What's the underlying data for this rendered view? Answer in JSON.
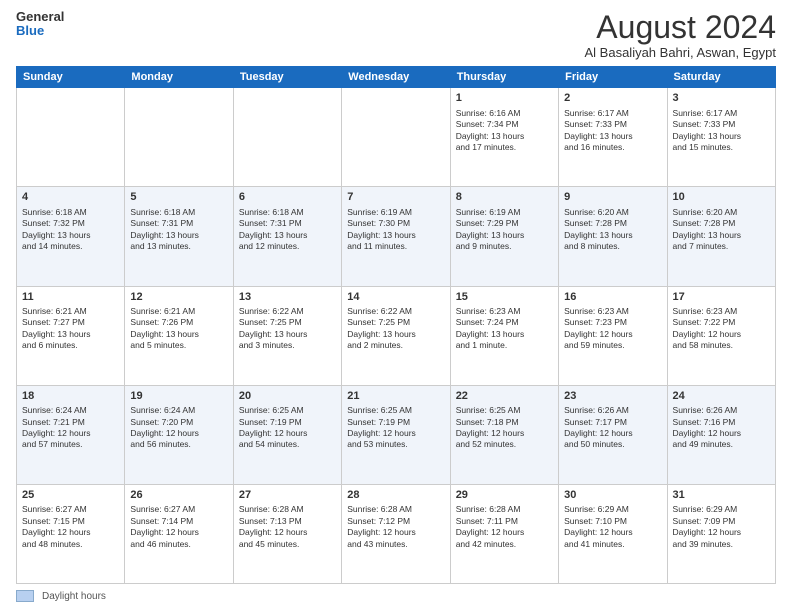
{
  "logo": {
    "line1": "General",
    "line2": "Blue"
  },
  "title": "August 2024",
  "subtitle": "Al Basaliyah Bahri, Aswan, Egypt",
  "days_of_week": [
    "Sunday",
    "Monday",
    "Tuesday",
    "Wednesday",
    "Thursday",
    "Friday",
    "Saturday"
  ],
  "weeks": [
    {
      "alt": false,
      "days": [
        {
          "num": "",
          "info": ""
        },
        {
          "num": "",
          "info": ""
        },
        {
          "num": "",
          "info": ""
        },
        {
          "num": "",
          "info": ""
        },
        {
          "num": "1",
          "info": "Sunrise: 6:16 AM\nSunset: 7:34 PM\nDaylight: 13 hours\nand 17 minutes."
        },
        {
          "num": "2",
          "info": "Sunrise: 6:17 AM\nSunset: 7:33 PM\nDaylight: 13 hours\nand 16 minutes."
        },
        {
          "num": "3",
          "info": "Sunrise: 6:17 AM\nSunset: 7:33 PM\nDaylight: 13 hours\nand 15 minutes."
        }
      ]
    },
    {
      "alt": true,
      "days": [
        {
          "num": "4",
          "info": "Sunrise: 6:18 AM\nSunset: 7:32 PM\nDaylight: 13 hours\nand 14 minutes."
        },
        {
          "num": "5",
          "info": "Sunrise: 6:18 AM\nSunset: 7:31 PM\nDaylight: 13 hours\nand 13 minutes."
        },
        {
          "num": "6",
          "info": "Sunrise: 6:18 AM\nSunset: 7:31 PM\nDaylight: 13 hours\nand 12 minutes."
        },
        {
          "num": "7",
          "info": "Sunrise: 6:19 AM\nSunset: 7:30 PM\nDaylight: 13 hours\nand 11 minutes."
        },
        {
          "num": "8",
          "info": "Sunrise: 6:19 AM\nSunset: 7:29 PM\nDaylight: 13 hours\nand 9 minutes."
        },
        {
          "num": "9",
          "info": "Sunrise: 6:20 AM\nSunset: 7:28 PM\nDaylight: 13 hours\nand 8 minutes."
        },
        {
          "num": "10",
          "info": "Sunrise: 6:20 AM\nSunset: 7:28 PM\nDaylight: 13 hours\nand 7 minutes."
        }
      ]
    },
    {
      "alt": false,
      "days": [
        {
          "num": "11",
          "info": "Sunrise: 6:21 AM\nSunset: 7:27 PM\nDaylight: 13 hours\nand 6 minutes."
        },
        {
          "num": "12",
          "info": "Sunrise: 6:21 AM\nSunset: 7:26 PM\nDaylight: 13 hours\nand 5 minutes."
        },
        {
          "num": "13",
          "info": "Sunrise: 6:22 AM\nSunset: 7:25 PM\nDaylight: 13 hours\nand 3 minutes."
        },
        {
          "num": "14",
          "info": "Sunrise: 6:22 AM\nSunset: 7:25 PM\nDaylight: 13 hours\nand 2 minutes."
        },
        {
          "num": "15",
          "info": "Sunrise: 6:23 AM\nSunset: 7:24 PM\nDaylight: 13 hours\nand 1 minute."
        },
        {
          "num": "16",
          "info": "Sunrise: 6:23 AM\nSunset: 7:23 PM\nDaylight: 12 hours\nand 59 minutes."
        },
        {
          "num": "17",
          "info": "Sunrise: 6:23 AM\nSunset: 7:22 PM\nDaylight: 12 hours\nand 58 minutes."
        }
      ]
    },
    {
      "alt": true,
      "days": [
        {
          "num": "18",
          "info": "Sunrise: 6:24 AM\nSunset: 7:21 PM\nDaylight: 12 hours\nand 57 minutes."
        },
        {
          "num": "19",
          "info": "Sunrise: 6:24 AM\nSunset: 7:20 PM\nDaylight: 12 hours\nand 56 minutes."
        },
        {
          "num": "20",
          "info": "Sunrise: 6:25 AM\nSunset: 7:19 PM\nDaylight: 12 hours\nand 54 minutes."
        },
        {
          "num": "21",
          "info": "Sunrise: 6:25 AM\nSunset: 7:19 PM\nDaylight: 12 hours\nand 53 minutes."
        },
        {
          "num": "22",
          "info": "Sunrise: 6:25 AM\nSunset: 7:18 PM\nDaylight: 12 hours\nand 52 minutes."
        },
        {
          "num": "23",
          "info": "Sunrise: 6:26 AM\nSunset: 7:17 PM\nDaylight: 12 hours\nand 50 minutes."
        },
        {
          "num": "24",
          "info": "Sunrise: 6:26 AM\nSunset: 7:16 PM\nDaylight: 12 hours\nand 49 minutes."
        }
      ]
    },
    {
      "alt": false,
      "days": [
        {
          "num": "25",
          "info": "Sunrise: 6:27 AM\nSunset: 7:15 PM\nDaylight: 12 hours\nand 48 minutes."
        },
        {
          "num": "26",
          "info": "Sunrise: 6:27 AM\nSunset: 7:14 PM\nDaylight: 12 hours\nand 46 minutes."
        },
        {
          "num": "27",
          "info": "Sunrise: 6:28 AM\nSunset: 7:13 PM\nDaylight: 12 hours\nand 45 minutes."
        },
        {
          "num": "28",
          "info": "Sunrise: 6:28 AM\nSunset: 7:12 PM\nDaylight: 12 hours\nand 43 minutes."
        },
        {
          "num": "29",
          "info": "Sunrise: 6:28 AM\nSunset: 7:11 PM\nDaylight: 12 hours\nand 42 minutes."
        },
        {
          "num": "30",
          "info": "Sunrise: 6:29 AM\nSunset: 7:10 PM\nDaylight: 12 hours\nand 41 minutes."
        },
        {
          "num": "31",
          "info": "Sunrise: 6:29 AM\nSunset: 7:09 PM\nDaylight: 12 hours\nand 39 minutes."
        }
      ]
    }
  ],
  "footer": {
    "legend_label": "Daylight hours"
  }
}
